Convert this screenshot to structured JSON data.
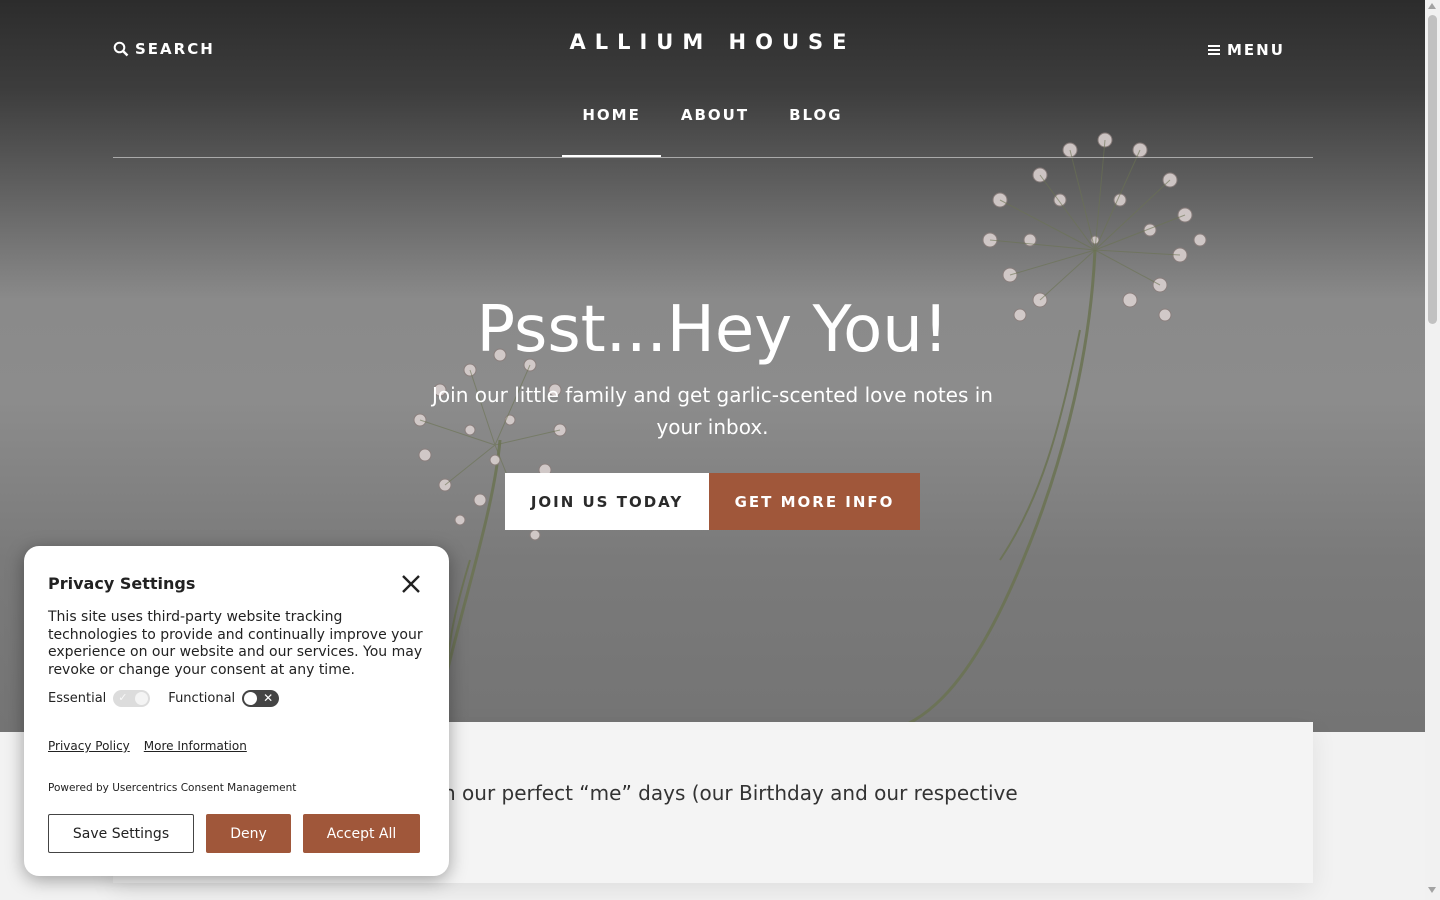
{
  "header": {
    "search_label": "SEARCH",
    "brand": "ALLIUM HOUSE",
    "menu_label": "MENU"
  },
  "nav": {
    "items": [
      {
        "label": "HOME",
        "active": true
      },
      {
        "label": "ABOUT",
        "active": false
      },
      {
        "label": "BLOG",
        "active": false
      }
    ]
  },
  "hero": {
    "title": "Psst...Hey You!",
    "subtitle": "Join our little family and get garlic-scented love notes in your inbox.",
    "join_button": "JOIN US TODAY",
    "info_button": "GET MORE INFO"
  },
  "content": {
    "partial_text": "n our perfect “me” days (our Birthday and our respective"
  },
  "privacy": {
    "title": "Privacy Settings",
    "body": "This site uses third-party website tracking technologies to provide and continually improve your experience on our website and our services. You may revoke or change your consent at any time.",
    "toggles": [
      {
        "label": "Essential",
        "on": true,
        "locked": true
      },
      {
        "label": "Functional",
        "on": false,
        "locked": false
      }
    ],
    "links": {
      "privacy_policy": "Privacy Policy",
      "more_info": "More Information"
    },
    "powered_by": "Powered by Usercentrics Consent Management",
    "buttons": {
      "save": "Save Settings",
      "deny": "Deny",
      "accept": "Accept All"
    }
  },
  "colors": {
    "accent": "#a0573a",
    "hero_dark": "#2c2c2c",
    "hero_mid": "#8a8a8a"
  },
  "icons": [
    "search-icon",
    "hamburger-icon",
    "close-icon",
    "check-icon",
    "x-icon"
  ]
}
